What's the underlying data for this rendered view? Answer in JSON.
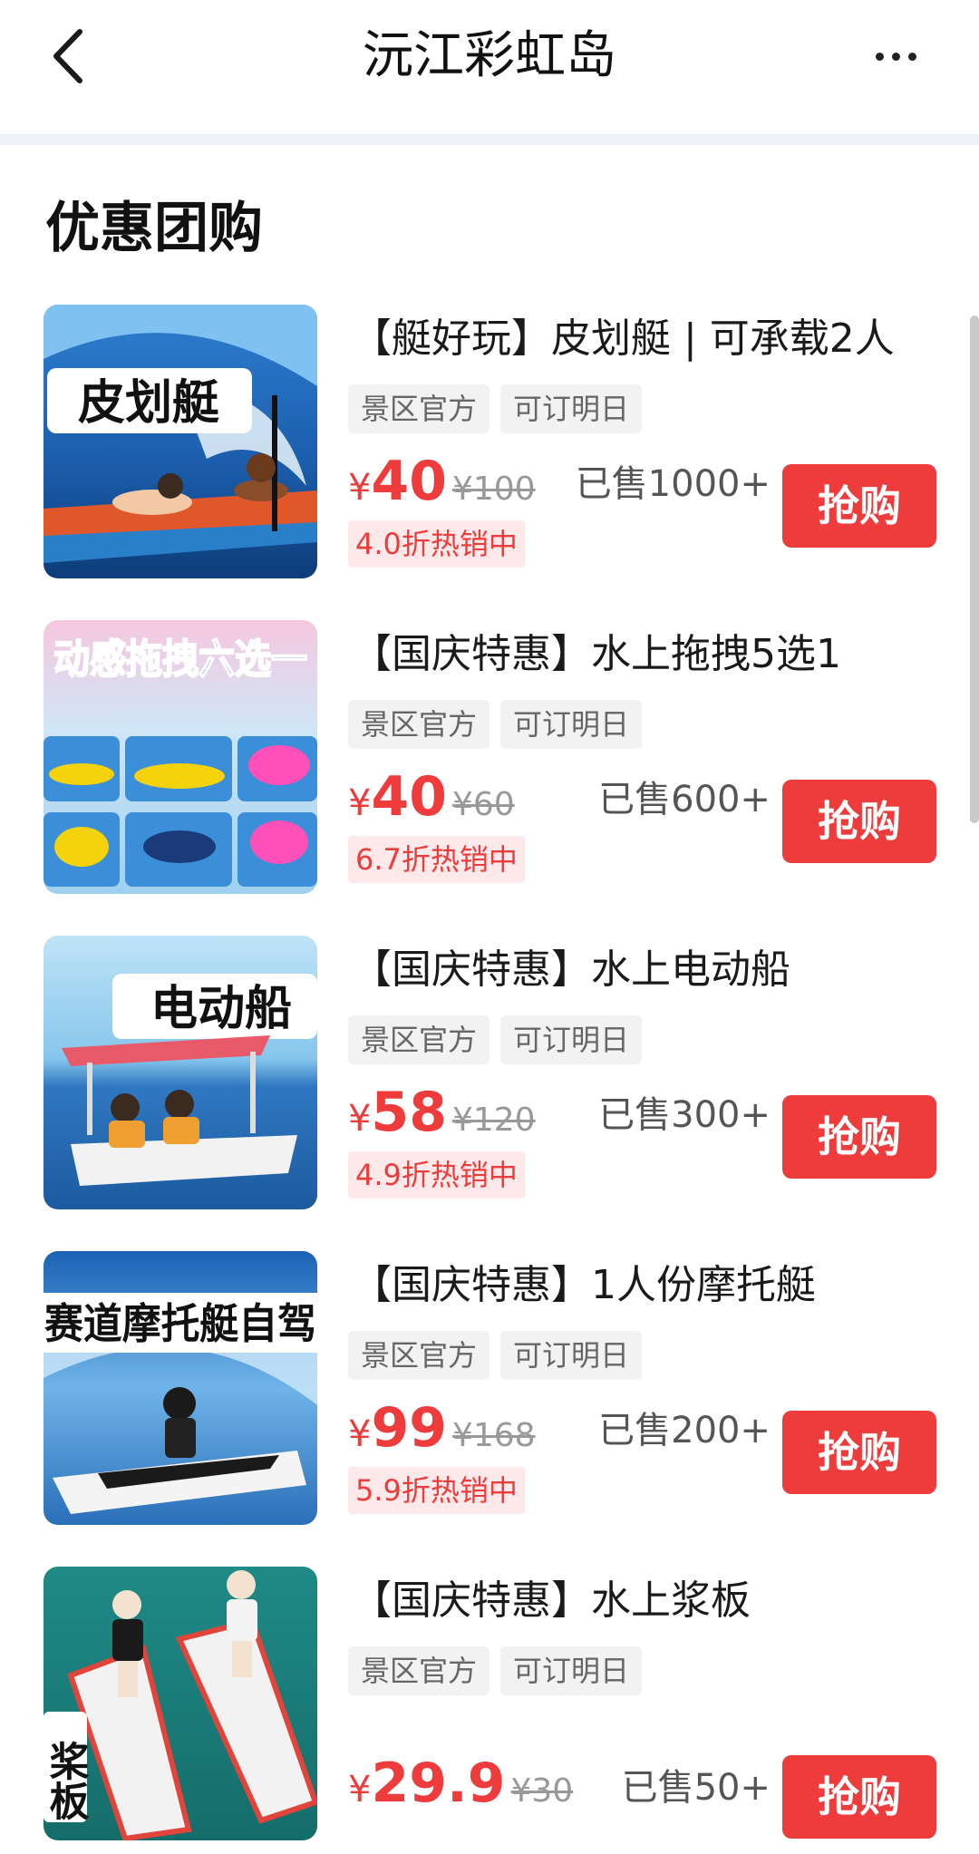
{
  "nav": {
    "title": "沅江彩虹岛",
    "back_icon": "chevron-left-icon",
    "more_icon": "more-horizontal-icon"
  },
  "section": {
    "title": "优惠团购"
  },
  "deals": [
    {
      "name": "【艇好玩】皮划艇 | 可承载2人",
      "tags": [
        "景区官方",
        "可订明日"
      ],
      "currency": "¥",
      "price": "40",
      "original_price": "¥100",
      "discount": "4.0折热销中",
      "sold": "已售1000+",
      "buy_label": "抢购",
      "thumb_text": "皮划艇"
    },
    {
      "name": "【国庆特惠】水上拖拽5选1",
      "tags": [
        "景区官方",
        "可订明日"
      ],
      "currency": "¥",
      "price": "40",
      "original_price": "¥60",
      "discount": "6.7折热销中",
      "sold": "已售600+",
      "buy_label": "抢购",
      "thumb_text": "动感拖拽六选一"
    },
    {
      "name": "【国庆特惠】水上电动船",
      "tags": [
        "景区官方",
        "可订明日"
      ],
      "currency": "¥",
      "price": "58",
      "original_price": "¥120",
      "discount": "4.9折热销中",
      "sold": "已售300+",
      "buy_label": "抢购",
      "thumb_text": "电动船"
    },
    {
      "name": "【国庆特惠】1人份摩托艇",
      "tags": [
        "景区官方",
        "可订明日"
      ],
      "currency": "¥",
      "price": "99",
      "original_price": "¥168",
      "discount": "5.9折热销中",
      "sold": "已售200+",
      "buy_label": "抢购",
      "thumb_text": "赛道摩托艇自驾"
    },
    {
      "name": "【国庆特惠】水上浆板",
      "tags": [
        "景区官方",
        "可订明日"
      ],
      "currency": "¥",
      "price": "29.9",
      "original_price": "¥30",
      "discount": "",
      "sold": "已售50+",
      "buy_label": "抢购",
      "thumb_text": "桨板"
    }
  ],
  "colors": {
    "accent": "#ee3b3b",
    "tag_bg": "#f2f2f2",
    "discount_bg": "#fde9e9",
    "divider": "#eff2f6"
  }
}
